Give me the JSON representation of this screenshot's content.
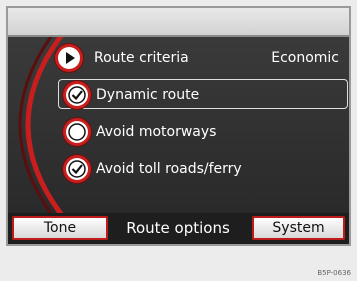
{
  "route_list": {
    "criteria": {
      "label": "Route criteria",
      "value": "Economic",
      "icon": "play-icon"
    },
    "items": [
      {
        "label": "Dynamic route",
        "checked": true,
        "selected": true
      },
      {
        "label": "Avoid motorways",
        "checked": false,
        "selected": false
      },
      {
        "label": "Avoid toll roads/ferry",
        "checked": true,
        "selected": false
      }
    ]
  },
  "bottom_bar": {
    "left_button": "Tone",
    "title": "Route options",
    "right_button": "System"
  },
  "figure_code": "B5P-0636",
  "colors": {
    "accent_red": "#c81e1e",
    "screen_bg": "#333333",
    "text": "#ffffff",
    "button_bg": "#e6e6e6"
  }
}
